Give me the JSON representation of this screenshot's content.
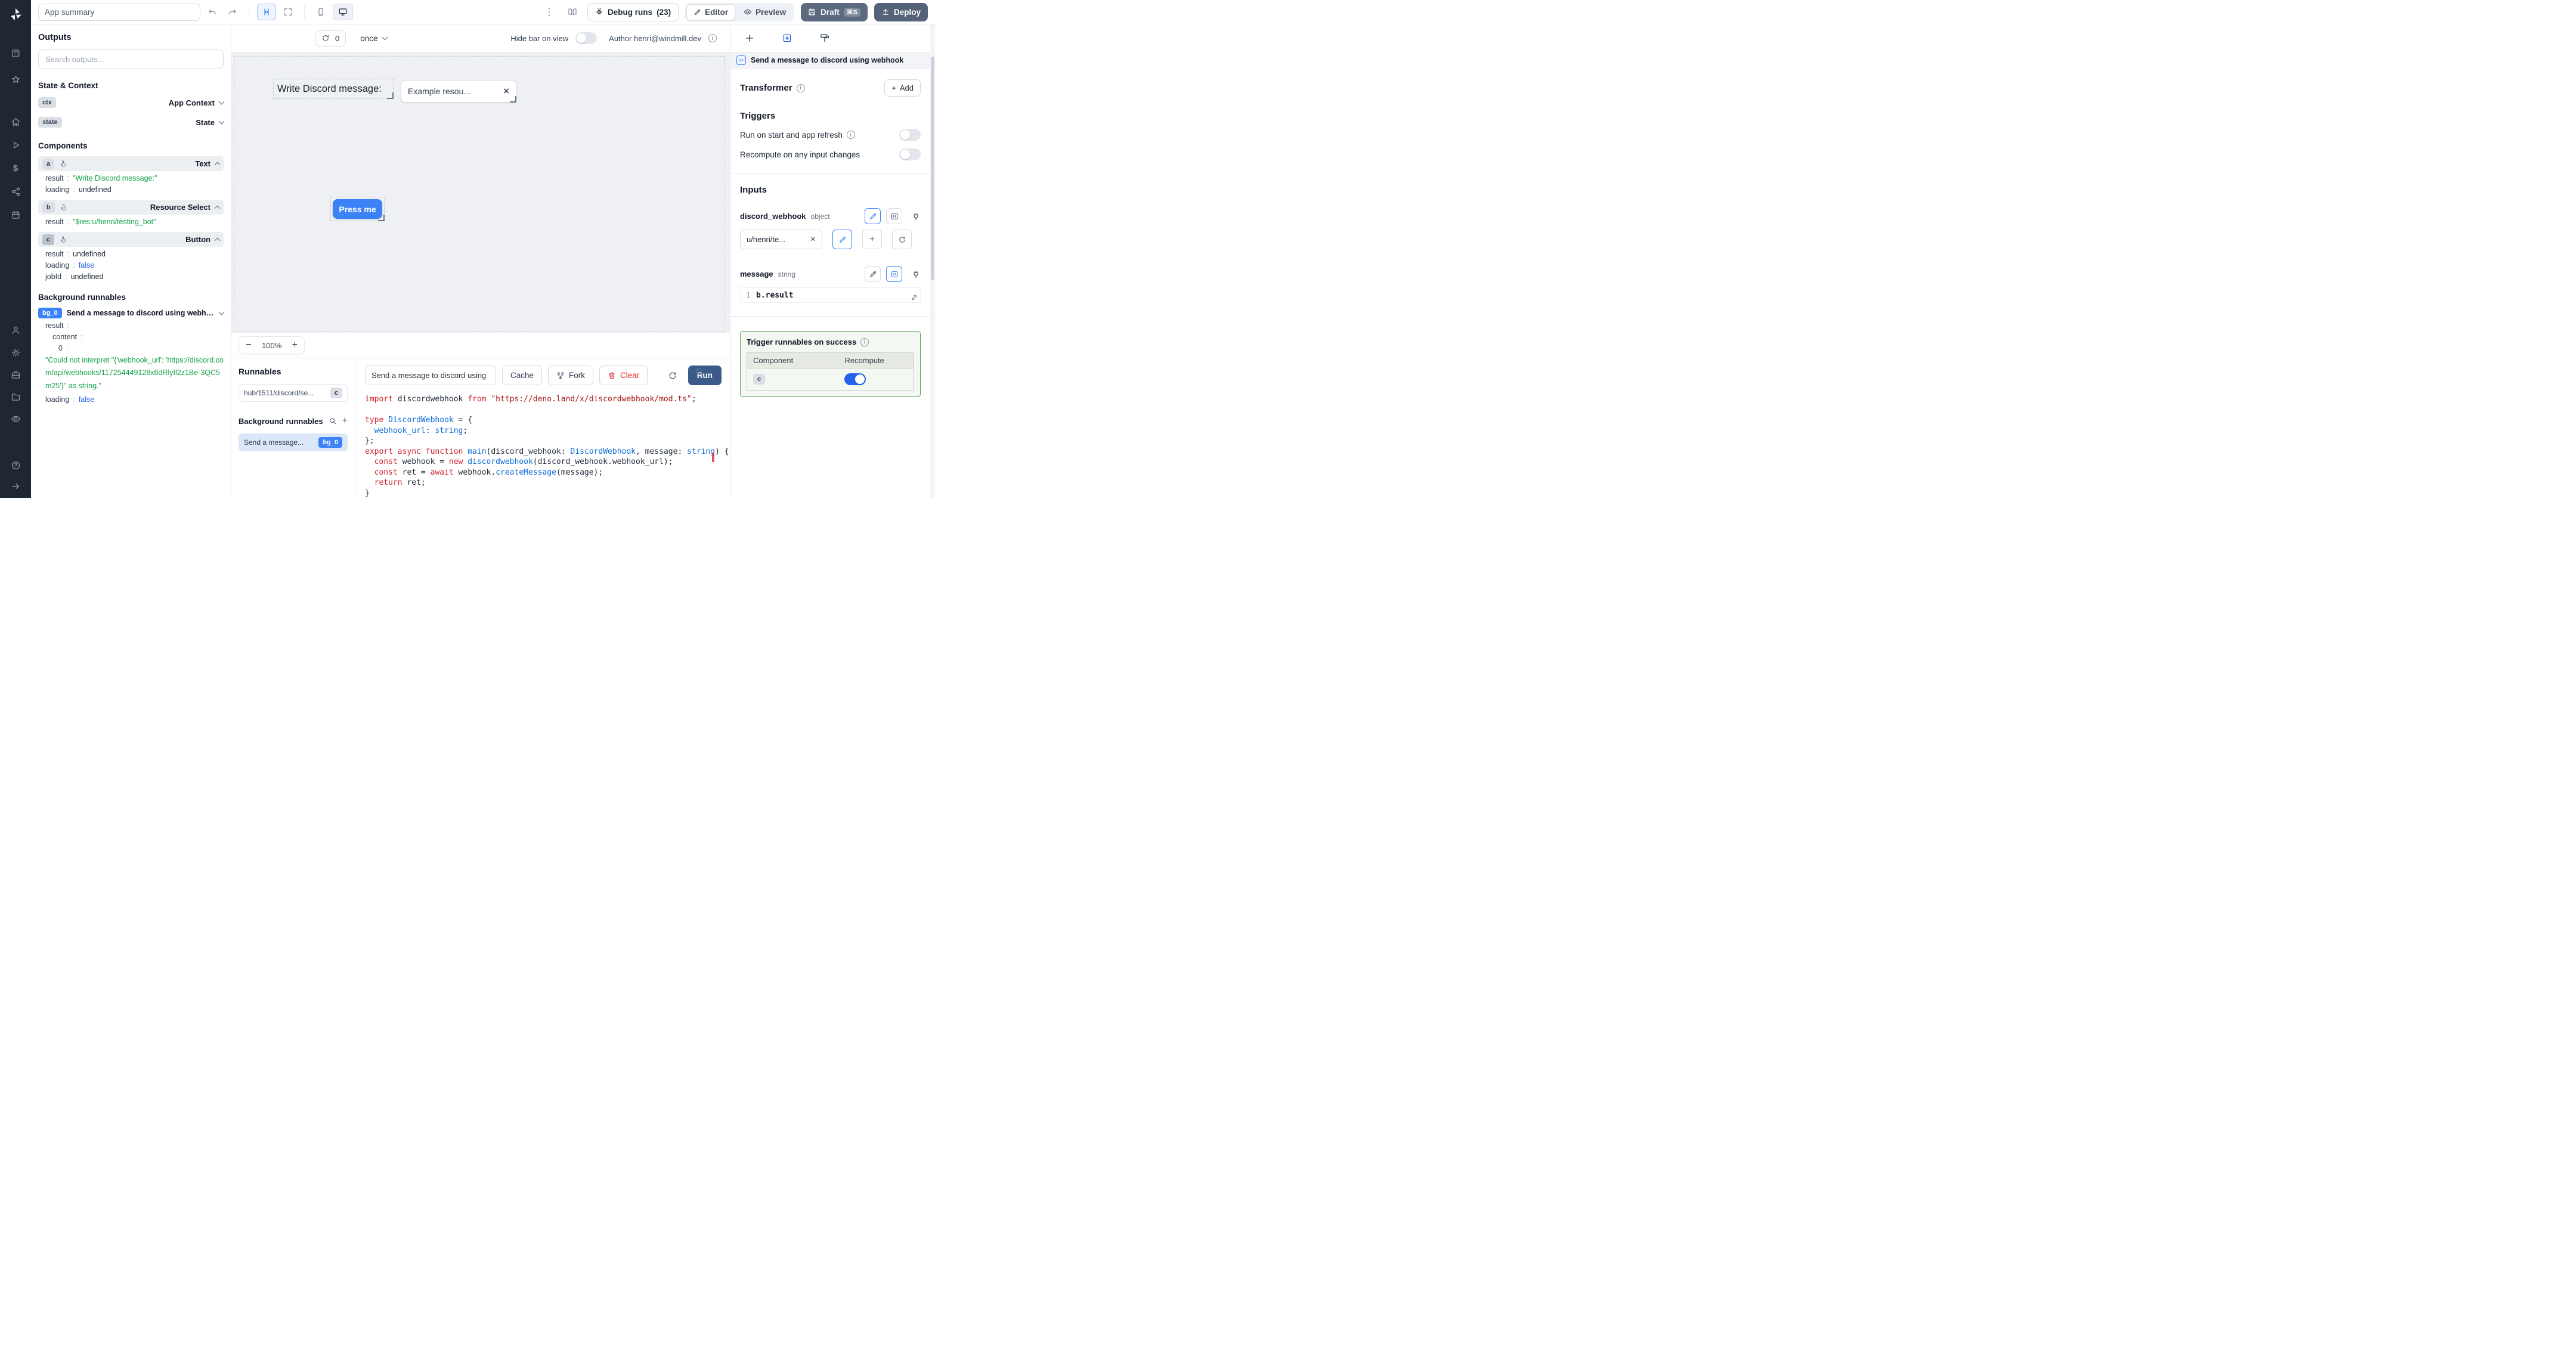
{
  "topbar": {
    "app_summary": "App summary",
    "dots_glyph": "⋮",
    "debug_runs_label": "Debug runs",
    "debug_runs_count": "(23)",
    "editor_label": "Editor",
    "preview_label": "Preview",
    "draft_label": "Draft",
    "draft_shortcut": "⌘S",
    "deploy_label": "Deploy"
  },
  "outputs": {
    "title": "Outputs",
    "search_placeholder": "Search outputs...",
    "sep": ":",
    "state_context_title": "State & Context",
    "ctx_badge": "ctx",
    "ctx_label": "App Context",
    "state_badge": "state",
    "state_label": "State",
    "components_title": "Components",
    "comp_a": {
      "badge": "a",
      "type": "Text",
      "rows": [
        {
          "key": "result",
          "value": "\"Write Discord message:\""
        },
        {
          "key": "loading",
          "value": "undefined"
        }
      ]
    },
    "comp_b": {
      "badge": "b",
      "type": "Resource Select",
      "rows": [
        {
          "key": "result",
          "value": "\"$res:u/henri/testing_bot\""
        }
      ]
    },
    "comp_c": {
      "badge": "c",
      "type": "Button",
      "rows": [
        {
          "key": "result",
          "value": "undefined"
        },
        {
          "key": "loading",
          "value": "false"
        },
        {
          "key": "jobId",
          "value": "undefined"
        }
      ]
    },
    "background_title": "Background runnables",
    "bg": {
      "badge": "bg_0",
      "name": "Send a message to discord using webhook",
      "rows": [
        {
          "key": "result"
        },
        {
          "key": "content"
        },
        {
          "key": "0"
        }
      ],
      "error_value": "\"Could not interpret \"{'webhook_url': 'https://discord.com/api/webhooks/117254449128x6dRlyIl2z1Be-3QC5m25'}\" as string.\"",
      "loading_key": "loading",
      "loading_value": "false"
    }
  },
  "canvas": {
    "recompute_count": "0",
    "schedule": "once",
    "hide_bar_label": "Hide bar on view",
    "author_label": "Author henri@windmill.dev",
    "text_component": "Write Discord message:",
    "select_value": "Example resou...",
    "clear_glyph": "×",
    "button_label": "Press me",
    "zoom_out": "−",
    "zoom_level": "100%",
    "zoom_in": "+"
  },
  "runnables": {
    "title": "Runnables",
    "item_path": "hub/1511/discord/se...",
    "item_badge": "c",
    "background_title": "Background runnables",
    "add_glyph": "+",
    "bg_item_name": "Send a message...",
    "bg_item_badge": "bg_0"
  },
  "code_panel": {
    "script_name": "Send a message to discord using",
    "cache_label": "Cache",
    "fork_label": "Fork",
    "clear_label": "Clear",
    "run_label": "Run",
    "lines": [
      [
        [
          "k",
          "import"
        ],
        [
          "p",
          " discordwebhook "
        ],
        [
          "k",
          "from"
        ],
        [
          "s",
          " \"https://deno.land/x/discordwebhook/mod.ts\""
        ],
        [
          "p",
          ";"
        ]
      ],
      [],
      [
        [
          "k",
          "type"
        ],
        [
          "t",
          " DiscordWebhook"
        ],
        [
          "p",
          " = {"
        ]
      ],
      [
        [
          "p",
          "  "
        ],
        [
          "t",
          "webhook_url"
        ],
        [
          "p",
          ": "
        ],
        [
          "t",
          "string"
        ],
        [
          "p",
          ";"
        ]
      ],
      [
        [
          "p",
          "};"
        ]
      ],
      [
        [
          "k",
          "export"
        ],
        [
          "k",
          " async"
        ],
        [
          "k",
          " function"
        ],
        [
          "f",
          " main"
        ],
        [
          "p",
          "(discord_webhook: "
        ],
        [
          "t",
          "DiscordWebhook"
        ],
        [
          "p",
          ", message: "
        ],
        [
          "t",
          "string"
        ],
        [
          "p",
          ") {"
        ]
      ],
      [
        [
          "p",
          "  "
        ],
        [
          "k",
          "const"
        ],
        [
          "p",
          " webhook = "
        ],
        [
          "k",
          "new"
        ],
        [
          "f",
          " discordwebhook"
        ],
        [
          "p",
          "(discord_webhook.webhook_url);"
        ]
      ],
      [
        [
          "p",
          "  "
        ],
        [
          "k",
          "const"
        ],
        [
          "p",
          " ret = "
        ],
        [
          "k",
          "await"
        ],
        [
          "p",
          " webhook."
        ],
        [
          "f",
          "createMessage"
        ],
        [
          "p",
          "(message);"
        ]
      ],
      [
        [
          "p",
          "  "
        ],
        [
          "k",
          "return"
        ],
        [
          "p",
          " ret;"
        ]
      ],
      [
        [
          "p",
          "}"
        ]
      ]
    ]
  },
  "inspector": {
    "header_title": "Send a message to discord using webhook",
    "transformer_title": "Transformer",
    "add_label": "Add",
    "add_glyph": "+",
    "triggers_title": "Triggers",
    "run_on_start_label": "Run on start and app refresh",
    "recompute_label": "Recompute on any input changes",
    "inputs_title": "Inputs",
    "input1_name": "discord_webhook",
    "input1_type": "object",
    "input1_value": "u/henri/te...",
    "clear_glyph": "×",
    "plus_glyph": "+",
    "input2_name": "message",
    "input2_type": "string",
    "input2_line_number": "1",
    "input2_expr": "b.result",
    "success_title": "Trigger runnables on success",
    "table": {
      "col1": "Component",
      "col2": "Recompute",
      "row_component": "c"
    }
  }
}
